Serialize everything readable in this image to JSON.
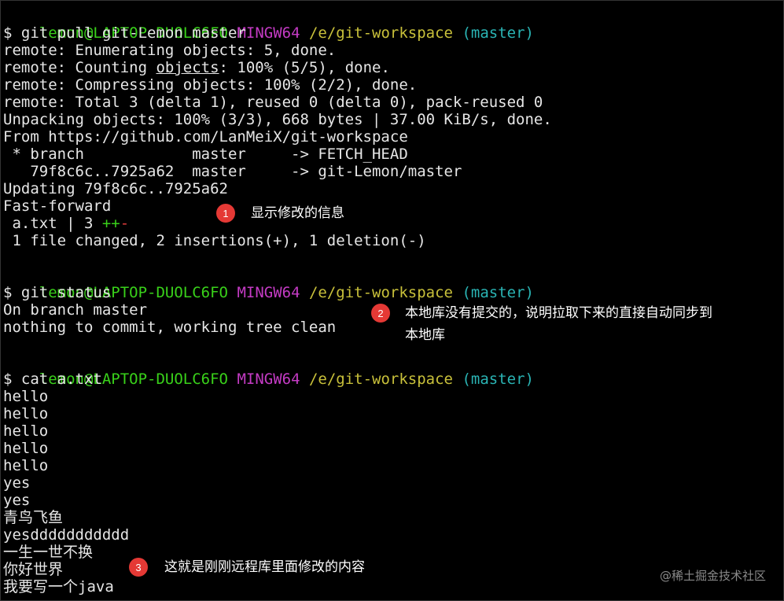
{
  "prompt": {
    "user": "lemon@LAPTOP-DUOLC6FO",
    "shell": "MINGW64",
    "path": "/e/git-workspace",
    "branch": "(master)"
  },
  "lines": {
    "l2": "$ git pull git-Lemon master",
    "l3": "remote: Enumerating objects: 5, done.",
    "l4a": "remote: Counting ",
    "l4b": "objects",
    "l4c": ": 100% (5/5), done.",
    "l5": "remote: Compressing objects: 100% (2/2), done.",
    "l6": "remote: Total 3 (delta 1), reused 0 (delta 0), pack-reused 0",
    "l7": "Unpacking objects: 100% (3/3), 668 bytes | 37.00 KiB/s, done.",
    "l8": "From https://github.com/LanMeiX/git-workspace",
    "l9": " * branch            master     -> FETCH_HEAD",
    "l10": "   79f8c6c..7925a62  master     -> git-Lemon/master",
    "l11": "Updating 79f8c6c..7925a62",
    "l12": "Fast-forward",
    "l13a": " a.txt | 3 ",
    "l13b": "++",
    "l13c": "-",
    "l14": " 1 file changed, 2 insertions(+), 1 deletion(-)",
    "l17": "$ git status",
    "l18": "On branch master",
    "l19": "nothing to commit, working tree clean",
    "l22": "$ cat a.txt",
    "l23": "hello",
    "l24": "hello",
    "l25": "hello",
    "l26": "hello",
    "l27": "hello",
    "l28": "yes",
    "l29": "yes",
    "l30": "青鸟飞鱼",
    "l31": "yesddddddddddd",
    "l32": "一生一世不换",
    "l33": "你好世界",
    "l34": "我要写一个java"
  },
  "annotations": {
    "a1": {
      "num": "1",
      "text": "显示修改的信息"
    },
    "a2": {
      "num": "2",
      "text1": "本地库没有提交的，说明拉取下来的直接自动同步到",
      "text2": "本地库"
    },
    "a3": {
      "num": "3",
      "text": "这就是刚刚远程库里面修改的内容"
    }
  },
  "watermark": "@稀土掘金技术社区",
  "colors": {
    "background": "#000000",
    "text": "#e6e6e6",
    "user": "#39d11a",
    "shell": "#c43bc4",
    "path": "#c8c03a",
    "branch": "#2ab4b4",
    "badge": "#e53935"
  }
}
